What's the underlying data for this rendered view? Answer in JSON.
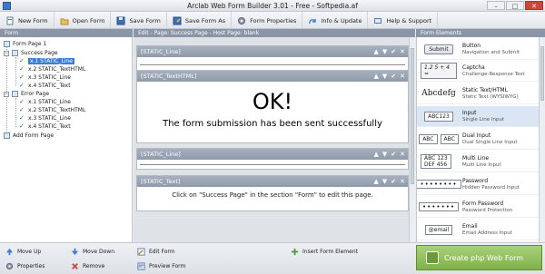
{
  "window": {
    "title": "Arclab Web Form Builder 3.01 - Free - Softpedia.af",
    "min": "–",
    "max": "□",
    "close": "✕"
  },
  "toolbar": [
    {
      "label": "New Form",
      "icon": "new-form-icon"
    },
    {
      "label": "Open Form",
      "icon": "open-folder-icon"
    },
    {
      "label": "Save Form",
      "icon": "save-icon"
    },
    {
      "label": "Save Form As",
      "icon": "save-as-icon"
    },
    {
      "label": "Form Properties",
      "icon": "gear-icon"
    },
    {
      "label": "Info & Update",
      "icon": "info-icon"
    },
    {
      "label": "Help & Support",
      "icon": "help-icon"
    }
  ],
  "panes": {
    "form_header": "Form",
    "edit_header": "Edit - Page: Success Page - Host Page: blank",
    "elements_header": "Form Elements"
  },
  "tree": [
    {
      "label": "Form Page 1",
      "kind": "page"
    },
    {
      "label": "Success Page",
      "kind": "page"
    },
    {
      "label": "x.1 STATIC_Line",
      "kind": "item",
      "selected": true
    },
    {
      "label": "x.2 STATIC_TextHTML",
      "kind": "item"
    },
    {
      "label": "x.3 STATIC_Line",
      "kind": "item"
    },
    {
      "label": "x.4 STATIC_Text",
      "kind": "item"
    },
    {
      "label": "Error Page",
      "kind": "page"
    },
    {
      "label": "x.1 STATIC_Line",
      "kind": "item"
    },
    {
      "label": "x.2 STATIC_TextHTML",
      "kind": "item"
    },
    {
      "label": "x.3 STATIC_Line",
      "kind": "item"
    },
    {
      "label": "x.4 STATIC_Text",
      "kind": "item"
    },
    {
      "label": "Add Form Page",
      "kind": "add"
    }
  ],
  "blocks": [
    {
      "header": "[STATIC_Line]"
    },
    {
      "header": "[STATIC_TextHTML]",
      "big": "OK!",
      "sub": "The form submission has been sent successfully"
    },
    {
      "header": "[STATIC_Line]"
    },
    {
      "header": "[STATIC_Text]",
      "text": "Click on \"Success Page\" in the section \"Form\" to edit this page."
    }
  ],
  "block_controls": [
    "▲",
    "▼",
    "✔",
    "✕"
  ],
  "elements": [
    {
      "preview": "Submit",
      "name": "Button",
      "desc": "Navigation and Submit"
    },
    {
      "preview": "1.2  5 + 4 =",
      "name": "Captcha",
      "desc": "Challenge-Response Test"
    },
    {
      "preview": "Abcdefg",
      "name": "Static Text/HTML",
      "desc": "Static Text (WYSIWYG)"
    },
    {
      "preview": "ABC123",
      "name": "Input",
      "desc": "Single Line Input"
    },
    {
      "preview_a": "ABC",
      "preview_b": "ABC",
      "name": "Dual Input",
      "desc": "Dual Single Line Input"
    },
    {
      "preview_a": "ABC 123",
      "preview_b": "DEF 456",
      "name": "Multi Line",
      "desc": "Multi Line Input"
    },
    {
      "preview": "••••••••",
      "name": "Password",
      "desc": "Hidden Password Input"
    },
    {
      "preview": "•••••••",
      "name": "Form Password",
      "desc": "Password Protection"
    },
    {
      "preview": "@email",
      "name": "Email",
      "desc": "Email Address Input"
    }
  ],
  "bottom": {
    "move_up": "Move Up",
    "move_down": "Move Down",
    "edit_form": "Edit Form",
    "insert_element": "Insert Form Element",
    "properties": "Properties",
    "remove": "Remove",
    "preview_form": "Preview Form",
    "create": "Create php Web Form"
  },
  "colors": {
    "accent": "#3b7fd4",
    "create_green": "#7fb24a",
    "remove_red": "#c9463d"
  }
}
